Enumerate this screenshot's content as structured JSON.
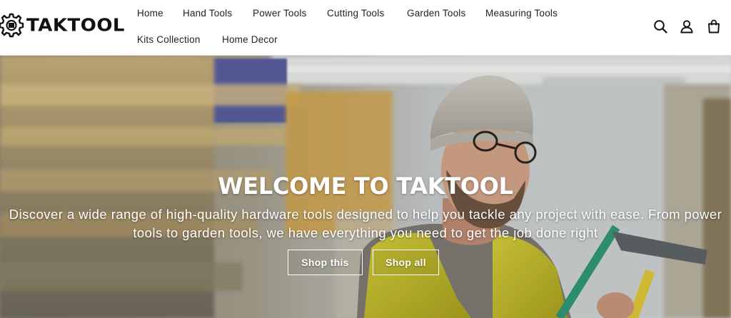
{
  "brand": {
    "name": "TAKTOOL"
  },
  "nav": {
    "items": [
      {
        "label": "Home"
      },
      {
        "label": "Hand Tools"
      },
      {
        "label": "Power Tools"
      },
      {
        "label": "Cutting Tools"
      },
      {
        "label": "Garden Tools"
      },
      {
        "label": "Measuring Tools"
      },
      {
        "label": "Kits Collection"
      },
      {
        "label": "Home Decor"
      }
    ]
  },
  "header_icons": [
    "search-icon",
    "account-icon",
    "cart-icon"
  ],
  "hero": {
    "title": "WELCOME TO TAKTOOL",
    "subtitle": "Discover a wide range of high-quality hardware tools designed to help you tackle any project with ease. From power tools to garden tools, we have everything you need to get the job done right",
    "buttons": [
      {
        "label": "Shop this"
      },
      {
        "label": "Shop all"
      }
    ]
  },
  "colors": {
    "text": "#222222",
    "hero_text": "#ffffff",
    "vest": "#c9c12a",
    "shelf_yellow": "#d9b24a"
  }
}
